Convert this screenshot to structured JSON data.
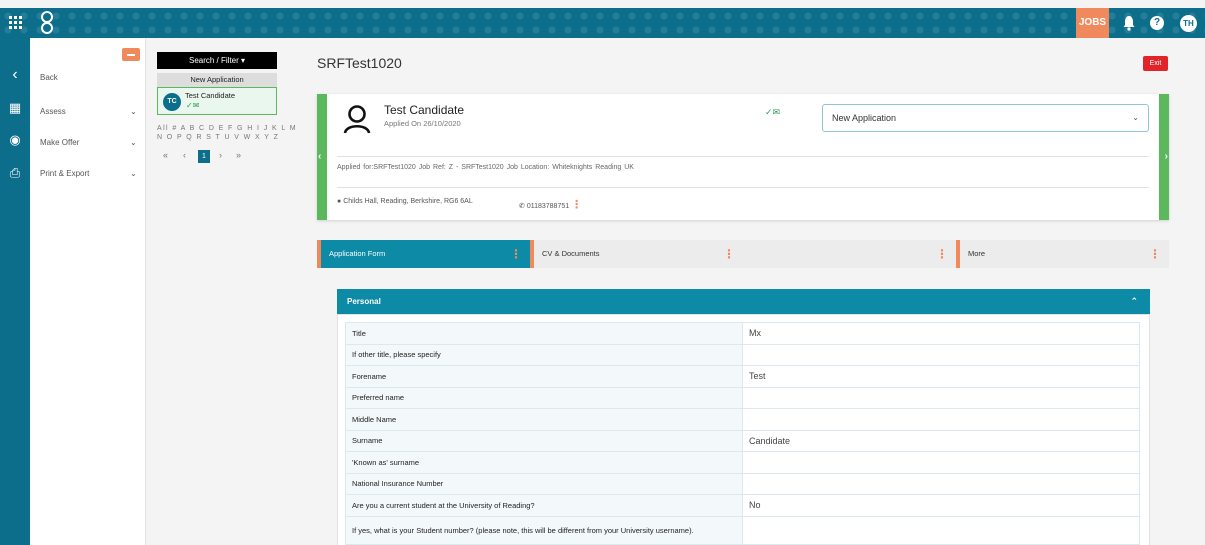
{
  "header": {
    "jobs_label": "JOBS",
    "user_initials": "TH"
  },
  "sidebar": {
    "back": "Back",
    "items": [
      {
        "label": "Assess"
      },
      {
        "label": "Make Offer"
      },
      {
        "label": "Print & Export"
      }
    ]
  },
  "candidate_list": {
    "search_label": "Search / Filter ▾",
    "group_header": "New Application",
    "candidates": [
      {
        "initials": "TC",
        "name": "Test Candidate"
      }
    ],
    "alphabet_line1": "All # A B C D E F G H I J K L M",
    "alphabet_line2": "N O P Q R S T U V W X Y Z",
    "pager": {
      "first": "«",
      "prev": "‹",
      "current": "1",
      "next": "›",
      "last": "»"
    }
  },
  "page": {
    "title": "SRFTest1020",
    "exit_label": "Exit"
  },
  "candidate_card": {
    "name": "Test Candidate",
    "applied_on": "Applied On 26/10/2020",
    "status_value": "New Application",
    "applied_for_line": "Applied for:SRFTest1020   Job Ref: Z - SRFTest1020   Job Location: Whiteknights Reading UK",
    "address": "Childs Hall, Reading, Berkshire, RG6 6AL",
    "phone": "01183788751"
  },
  "tabs": [
    {
      "label": "Application Form"
    },
    {
      "label": "CV & Documents"
    },
    {
      "label": ""
    },
    {
      "label": "More"
    }
  ],
  "personal_section": {
    "title": "Personal",
    "rows": [
      {
        "label": "Title",
        "value": "Mx"
      },
      {
        "label": "If other title, please specify",
        "value": ""
      },
      {
        "label": "Forename",
        "value": "Test"
      },
      {
        "label": "Preferred name",
        "value": ""
      },
      {
        "label": "Middle Name",
        "value": ""
      },
      {
        "label": "Surname",
        "value": "Candidate"
      },
      {
        "label": "'Known as' surname",
        "value": ""
      },
      {
        "label": "National Insurance Number",
        "value": ""
      },
      {
        "label": "Are you a current student at the University of Reading?",
        "value": "No"
      },
      {
        "label": "If yes, what is your Student number? (please note, this will be different from your University username).",
        "value": ""
      }
    ]
  },
  "colors": {
    "brand_teal": "#0d6e8c",
    "accent_orange": "#f08a5d",
    "status_green": "#5cb85c",
    "exit_red": "#e2242a"
  }
}
